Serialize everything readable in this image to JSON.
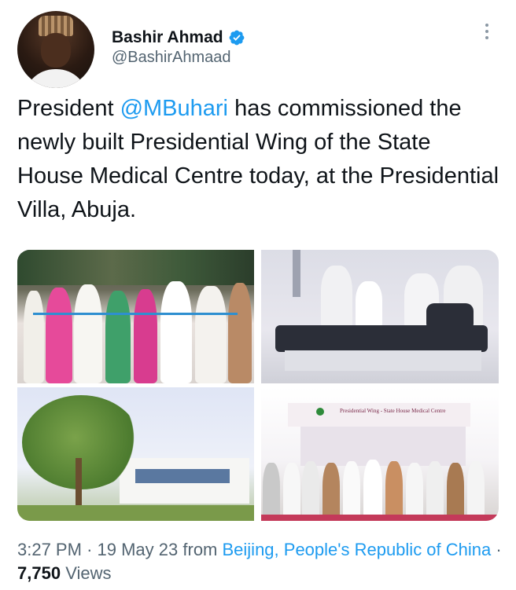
{
  "author": {
    "display_name": "Bashir Ahmad",
    "handle": "@BashirAhmaad",
    "verified": true
  },
  "tweet": {
    "text_before": "President ",
    "mention": "@MBuhari",
    "text_after": " has commissioned the newly built Presidential Wing of the State House Medical Centre today, at the Presidential Villa, Abuja."
  },
  "media": {
    "photos": [
      "ribbon-cutting-photo",
      "hospital-room-photo",
      "building-exterior-photo",
      "group-photo"
    ],
    "signage_text": "Presidential Wing - State House Medical Centre"
  },
  "footer": {
    "time": "3:27 PM",
    "date": "19 May 23",
    "from_label": "from",
    "location": "Beijing, People's Republic of China",
    "views_count": "7,750",
    "views_label": "Views"
  },
  "colors": {
    "accent": "#1d9bf0",
    "text": "#0f1419",
    "muted": "#536471"
  },
  "icons": [
    "verified-badge-icon",
    "more-options-icon"
  ]
}
